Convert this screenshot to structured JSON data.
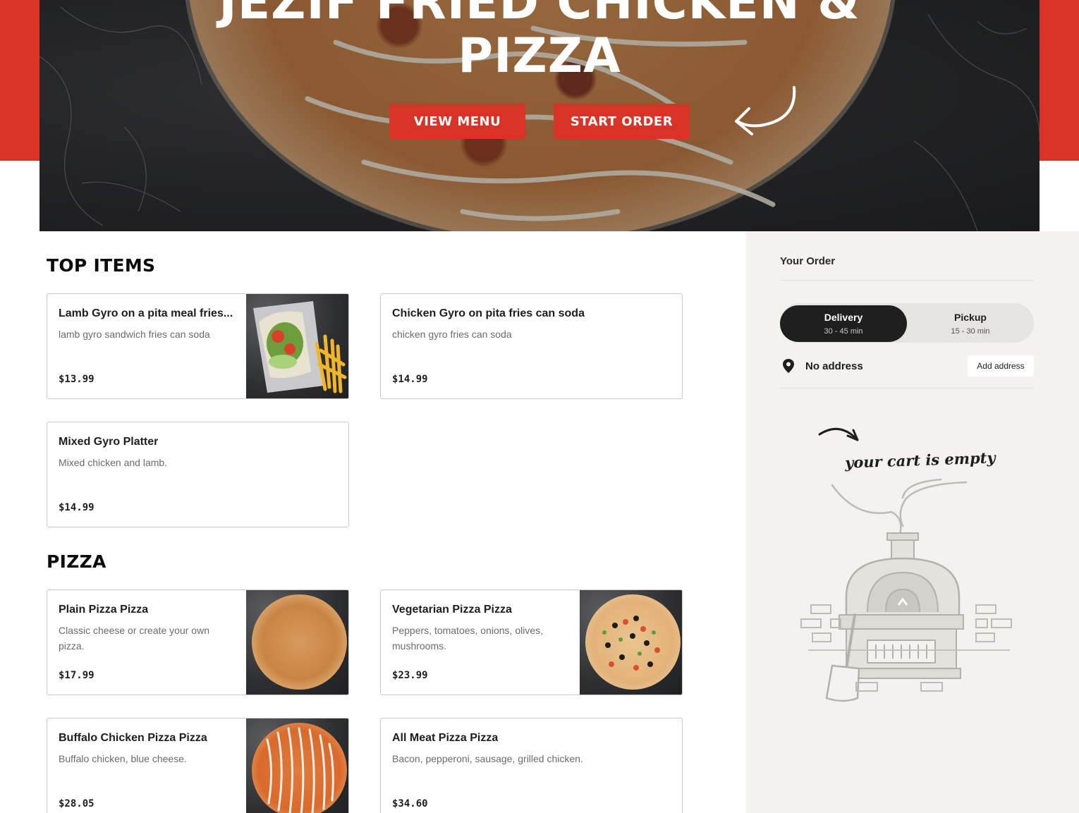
{
  "hero": {
    "title_line1": "JEZIF FRIED CHICKEN &",
    "title_line2": "PIZZA",
    "view_menu_label": "VIEW MENU",
    "start_order_label": "START ORDER"
  },
  "sections": [
    {
      "title": "TOP ITEMS",
      "items": [
        {
          "name": "Lamb Gyro on a pita meal fries...",
          "description": "lamb gyro sandwich fries can soda",
          "price": "$13.99",
          "has_image": true
        },
        {
          "name": "Chicken Gyro on pita fries can soda",
          "description": "chicken gyro fries can soda",
          "price": "$14.99",
          "has_image": false
        },
        {
          "name": "Mixed Gyro Platter",
          "description": "Mixed chicken and lamb.",
          "price": "$14.99",
          "has_image": false
        }
      ]
    },
    {
      "title": "PIZZA",
      "items": [
        {
          "name": "Plain Pizza Pizza",
          "description": "Classic cheese or create your own pizza.",
          "price": "$17.99",
          "has_image": true
        },
        {
          "name": "Vegetarian Pizza Pizza",
          "description": "Peppers, tomatoes, onions, olives, mushrooms.",
          "price": "$23.99",
          "has_image": true
        },
        {
          "name": "Buffalo Chicken Pizza Pizza",
          "description": "Buffalo chicken, blue cheese.",
          "price": "$28.05",
          "has_image": true
        },
        {
          "name": "All Meat Pizza Pizza",
          "description": "Bacon, pepperoni, sausage, grilled chicken.",
          "price": "$34.60",
          "has_image": false
        }
      ]
    }
  ],
  "order": {
    "title": "Your Order",
    "delivery": {
      "label": "Delivery",
      "time": "30 - 45 min"
    },
    "pickup": {
      "label": "Pickup",
      "time": "15 - 30 min"
    },
    "address": "No address",
    "add_address_label": "Add address",
    "empty_text": "your cart is empty"
  },
  "colors": {
    "brand_red": "#d93226",
    "panel_bg": "#f3f2ef",
    "toggle_active": "#1f1f1f"
  },
  "icons": {
    "location": "location-pin-icon",
    "hero_arrow": "curved-arrow-icon",
    "empty_cart": "pizza-oven-illustration"
  }
}
